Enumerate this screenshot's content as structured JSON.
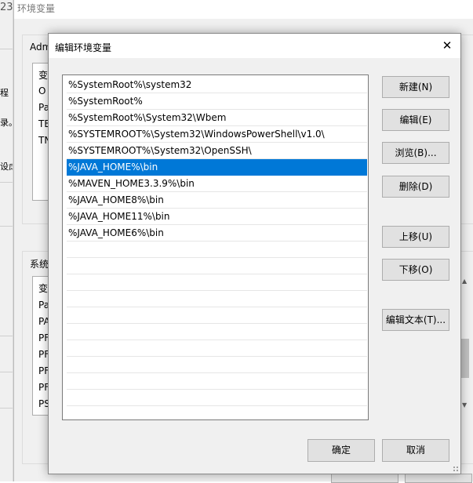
{
  "parent_window": {
    "title_fragment": "23",
    "text_fragments": [
      "程",
      "录。",
      "设虑"
    ]
  },
  "env_window": {
    "title": "环境变量",
    "user_group_label": "Adm",
    "user_list_rows": [
      "变",
      "O",
      "Pa",
      "TE",
      "TN"
    ],
    "system_group_label": "系统",
    "system_list_rows": [
      "变",
      "Pa",
      "PA",
      "PF",
      "PF",
      "PF",
      "PF",
      "PS"
    ]
  },
  "dialog": {
    "title": "编辑环境变量",
    "close_label": "✕",
    "paths": [
      "%SystemRoot%\\system32",
      "%SystemRoot%",
      "%SystemRoot%\\System32\\Wbem",
      "%SYSTEMROOT%\\System32\\WindowsPowerShell\\v1.0\\",
      "%SYSTEMROOT%\\System32\\OpenSSH\\",
      "%JAVA_HOME%\\bin",
      "%MAVEN_HOME3.3.9%\\bin",
      "%JAVA_HOME8%\\bin",
      "%JAVA_HOME11%\\bin",
      "%JAVA_HOME6%\\bin"
    ],
    "selected_index": 5,
    "buttons": {
      "new": "新建(N)",
      "edit": "编辑(E)",
      "browse": "浏览(B)...",
      "delete": "删除(D)",
      "move_up": "上移(U)",
      "move_down": "下移(O)",
      "edit_text": "编辑文本(T)...",
      "ok": "确定",
      "cancel": "取消"
    }
  },
  "colors": {
    "selection": "#0078d7",
    "button_face": "#e1e1e1",
    "dialog_bg": "#f0f0f0"
  }
}
